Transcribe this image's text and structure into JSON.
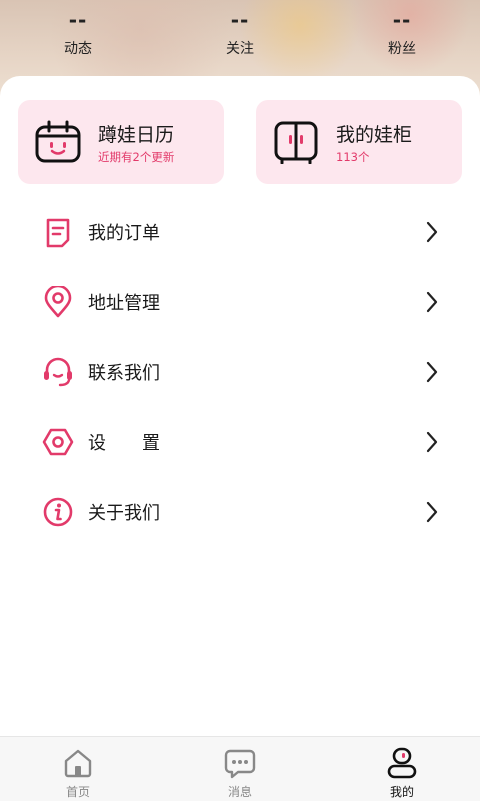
{
  "stats": [
    {
      "value": "--",
      "label": "动态"
    },
    {
      "value": "--",
      "label": "关注"
    },
    {
      "value": "--",
      "label": "粉丝"
    }
  ],
  "cards": {
    "calendar": {
      "title": "蹲娃日历",
      "subtitle": "近期有2个更新"
    },
    "cabinet": {
      "title": "我的娃柜",
      "subtitle": "113个"
    }
  },
  "menu": [
    {
      "label": "我的订单",
      "icon": "order-icon"
    },
    {
      "label": "地址管理",
      "icon": "location-pin-icon"
    },
    {
      "label": "联系我们",
      "icon": "headset-icon"
    },
    {
      "label": "设　　置",
      "icon": "settings-hexagon-icon"
    },
    {
      "label": "关于我们",
      "icon": "info-icon"
    }
  ],
  "tabs": [
    {
      "label": "首页",
      "icon": "home-icon"
    },
    {
      "label": "消息",
      "icon": "message-icon"
    },
    {
      "label": "我的",
      "icon": "profile-icon",
      "active": true
    }
  ],
  "colors": {
    "accent": "#e23a6a",
    "card_bg": "#fde7ee"
  }
}
